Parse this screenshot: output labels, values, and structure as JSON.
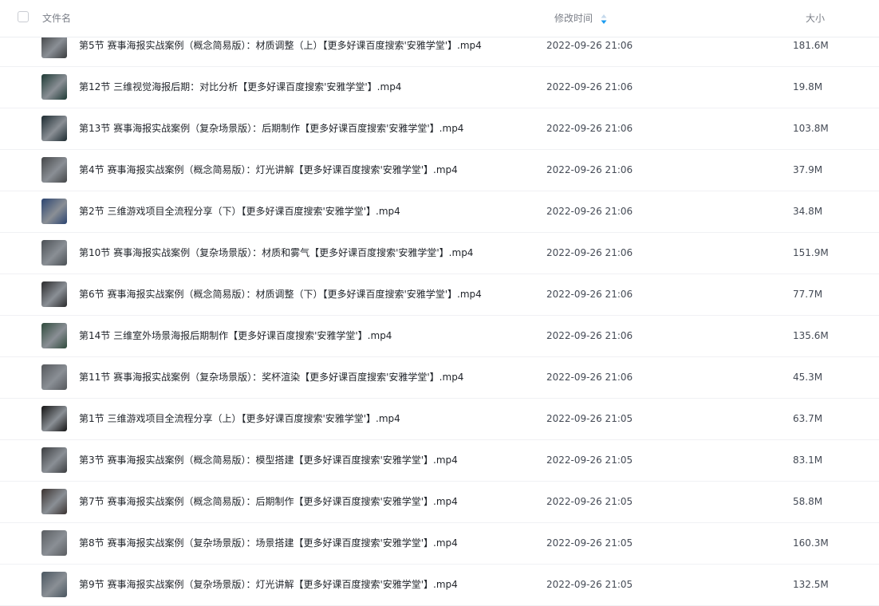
{
  "header": {
    "name_label": "文件名",
    "time_label": "修改时间",
    "size_label": "大小",
    "sort_icon": "sort-down-icon",
    "sort_color": "#1a9bf0"
  },
  "files": [
    {
      "name": "第5节 赛事海报实战案例（概念简易版）：材质调整（上）【更多好课百度搜索'安雅学堂'】.mp4",
      "time": "2022-09-26 21:06",
      "size": "181.6M",
      "thumb_color": "#3a3c3e"
    },
    {
      "name": "第12节 三维视觉海报后期：对比分析【更多好课百度搜索'安雅学堂'】.mp4",
      "time": "2022-09-26 21:06",
      "size": "19.8M",
      "thumb_color": "#1e3a35"
    },
    {
      "name": "第13节 赛事海报实战案例（复杂场景版）：后期制作【更多好课百度搜索'安雅学堂'】.mp4",
      "time": "2022-09-26 21:06",
      "size": "103.8M",
      "thumb_color": "#1c2a30"
    },
    {
      "name": "第4节 赛事海报实战案例（概念简易版）：灯光讲解【更多好课百度搜索'安雅学堂'】.mp4",
      "time": "2022-09-26 21:06",
      "size": "37.9M",
      "thumb_color": "#444648"
    },
    {
      "name": "第2节 三维游戏项目全流程分享（下）【更多好课百度搜索'安雅学堂'】.mp4",
      "time": "2022-09-26 21:06",
      "size": "34.8M",
      "thumb_color": "#2b4470"
    },
    {
      "name": "第10节 赛事海报实战案例（复杂场景版）：材质和雾气【更多好课百度搜索'安雅学堂'】.mp4",
      "time": "2022-09-26 21:06",
      "size": "151.9M",
      "thumb_color": "#4b5055"
    },
    {
      "name": "第6节 赛事海报实战案例（概念简易版）：材质调整（下）【更多好课百度搜索'安雅学堂'】.mp4",
      "time": "2022-09-26 21:06",
      "size": "77.7M",
      "thumb_color": "#2a2a2c"
    },
    {
      "name": "第14节 三维室外场景海报后期制作【更多好课百度搜索'安雅学堂'】.mp4",
      "time": "2022-09-26 21:06",
      "size": "135.6M",
      "thumb_color": "#2f4a3c"
    },
    {
      "name": "第11节 赛事海报实战案例（复杂场景版）：奖杯渲染【更多好课百度搜索'安雅学堂'】.mp4",
      "time": "2022-09-26 21:06",
      "size": "45.3M",
      "thumb_color": "#55585c"
    },
    {
      "name": "第1节 三维游戏项目全流程分享（上）【更多好课百度搜索'安雅学堂'】.mp4",
      "time": "2022-09-26 21:05",
      "size": "63.7M",
      "thumb_color": "#141414"
    },
    {
      "name": "第3节 赛事海报实战案例（概念简易版）：模型搭建【更多好课百度搜索'安雅学堂'】.mp4",
      "time": "2022-09-26 21:05",
      "size": "83.1M",
      "thumb_color": "#3b3d40"
    },
    {
      "name": "第7节 赛事海报实战案例（概念简易版）：后期制作【更多好课百度搜索'安雅学堂'】.mp4",
      "time": "2022-09-26 21:05",
      "size": "58.8M",
      "thumb_color": "#3a3230"
    },
    {
      "name": "第8节 赛事海报实战案例（复杂场景版）：场景搭建【更多好课百度搜索'安雅学堂'】.mp4",
      "time": "2022-09-26 21:05",
      "size": "160.3M",
      "thumb_color": "#5a5d61"
    },
    {
      "name": "第9节 赛事海报实战案例（复杂场景版）：灯光讲解【更多好课百度搜索'安雅学堂'】.mp4",
      "time": "2022-09-26 21:05",
      "size": "132.5M",
      "thumb_color": "#4a5660"
    }
  ]
}
